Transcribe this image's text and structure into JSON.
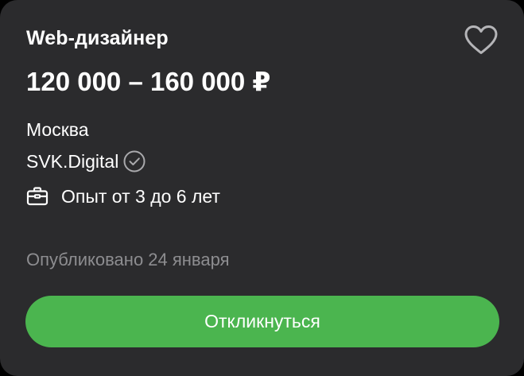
{
  "vacancy": {
    "title": "Web-дизайнер",
    "salary": "120 000 – 160 000 ₽",
    "city": "Москва",
    "company": "SVK.Digital",
    "experience": "Опыт от 3 до 6 лет",
    "published": "Опубликовано 24 января",
    "apply_label": "Откликнуться"
  },
  "icons": {
    "favorite": "heart-outline-icon",
    "verified": "check-circle-icon",
    "experience": "briefcase-icon"
  },
  "colors": {
    "card_background": "#2b2b2d",
    "accent_green": "#4bb54f",
    "muted_text": "#8d8d90",
    "icon_gray": "#b5b5b8"
  }
}
